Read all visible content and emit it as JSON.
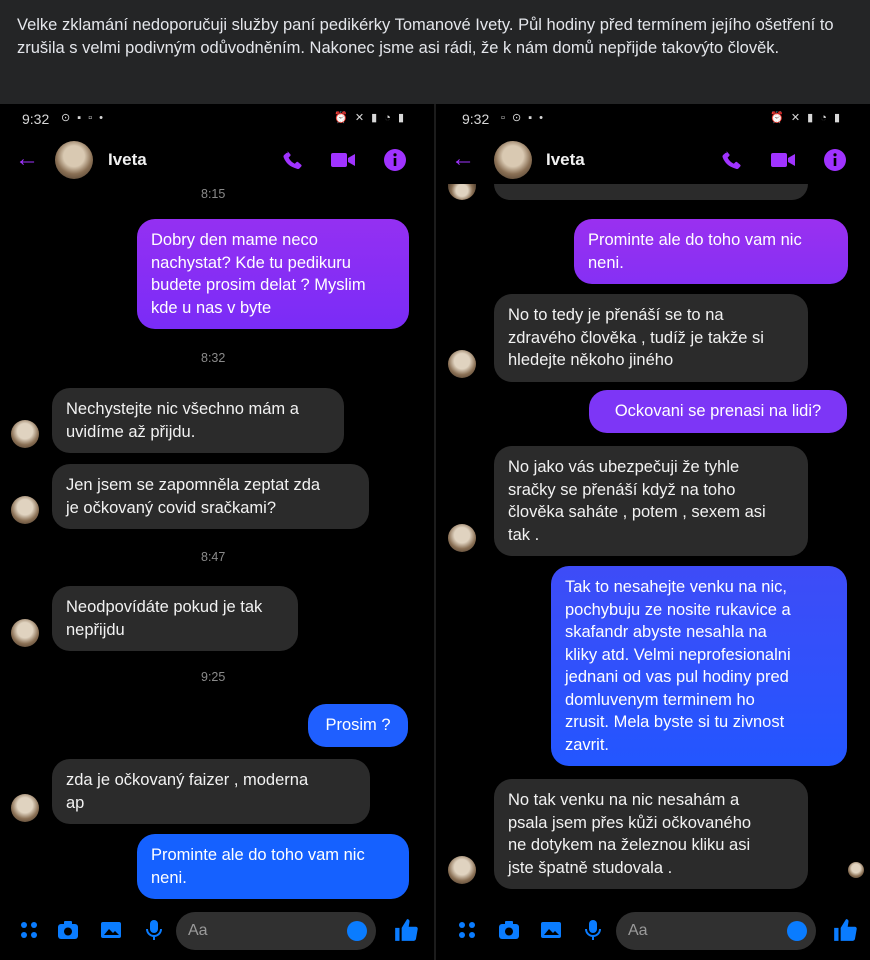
{
  "caption": "Velke zklamání nedoporučuji služby paní pedikérky Tomanové Ivety. Půl hodiny před termínem jejího ošetření to zrušila s velmi podivným odůvodněním. Nakonec jsme asi rádi, že k nám domů nepřijde takovýto člověk.",
  "colors": {
    "accent": "#a033ff",
    "incoming_bubble": "#2b2b2b",
    "outgoing_purple": "#8b2cf5",
    "outgoing_blue": "#1f63ff"
  },
  "left": {
    "status": {
      "time": "9:32"
    },
    "contact": "Iveta",
    "top_timestamp": "8:15",
    "messages": [
      {
        "type": "out",
        "text": "Dobry den mame neco\nnachystat? Kde tu pedikuru\nbudete prosim delat ? Myslim\nkde u nas v byte"
      },
      {
        "type": "ts",
        "text": "8:32"
      },
      {
        "type": "in",
        "text": "Nechystejte nic všechno mám a\nuvidíme až přijdu."
      },
      {
        "type": "in",
        "text": "Jen jsem se zapomněla zeptat zda\nje očkovaný covid sračkami?"
      },
      {
        "type": "ts",
        "text": "8:47"
      },
      {
        "type": "in",
        "text": "Neodpovídáte pokud je tak\nnepřijdu"
      },
      {
        "type": "ts",
        "text": "9:25"
      },
      {
        "type": "out",
        "text": "Prosim ?"
      },
      {
        "type": "in",
        "text": "zda je očkovaný faizer , moderna\nap"
      },
      {
        "type": "out",
        "text": "Prominte ale do toho vam nic\nneni."
      }
    ],
    "composer_placeholder": "Aa"
  },
  "right": {
    "status": {
      "time": "9:32"
    },
    "contact": "Iveta",
    "messages": [
      {
        "type": "out",
        "text": "Prominte ale do toho vam nic\nneni."
      },
      {
        "type": "in",
        "text": "No to tedy je přenáší se to na\nzdravého člověka , tudíž je takže si\nhledejte někoho jiného"
      },
      {
        "type": "out",
        "text": "Ockovani se prenasi na lidi?"
      },
      {
        "type": "in",
        "text": "No jako  vás ubezpečuji že tyhle\nsračky se přenáší když na toho\nčlověka saháte , potem , sexem asi\ntak ."
      },
      {
        "type": "out",
        "text": "Tak to nesahejte venku na nic,\npochybuju ze nosite rukavice a\nskafandr abyste nesahla na\nkliky atd. Velmi neprofesionalni\njednani od vas pul hodiny pred\ndomluvenym terminem ho\nzrusit. Mela byste si tu zivnost\nzavrit."
      },
      {
        "type": "in",
        "text": "No tak venku na nic nesahám a\npsala jsem přes kůži očkovaného\nne dotykem na železnou kliku asi\njste špatně studovala ."
      }
    ],
    "composer_placeholder": "Aa"
  }
}
